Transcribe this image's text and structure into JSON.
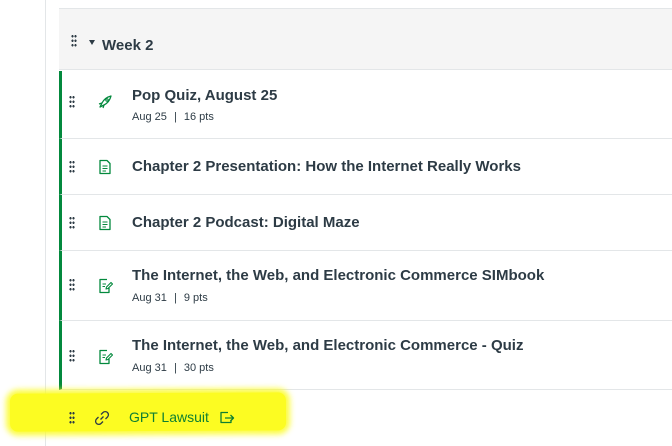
{
  "module": {
    "title": "Week 2",
    "items": [
      {
        "title": "Pop Quiz, August 25",
        "due": "Aug 25",
        "points": "16 pts",
        "separator": "|",
        "icon": "quiz-rocket-icon"
      },
      {
        "title": "Chapter 2 Presentation: How the Internet Really Works",
        "icon": "page-icon"
      },
      {
        "title": "Chapter 2 Podcast: Digital Maze",
        "icon": "page-icon"
      },
      {
        "title": "The Internet, the Web, and Electronic Commerce SIMbook",
        "due": "Aug 31",
        "points": "9 pts",
        "separator": "|",
        "icon": "assignment-icon"
      },
      {
        "title": "The Internet, the Web, and Electronic Commerce - Quiz",
        "due": "Aug 31",
        "points": "30 pts",
        "separator": "|",
        "icon": "assignment-icon"
      },
      {
        "title": "GPT Lawsuit",
        "icon": "link-icon",
        "trailing_icon": "external-link-icon"
      }
    ]
  },
  "colors": {
    "text": "#2d3b45",
    "published_bar": "#03893d",
    "link_text": "#0e7f32",
    "highlight": "#fcfc22",
    "header_bg": "#f5f5f5"
  }
}
